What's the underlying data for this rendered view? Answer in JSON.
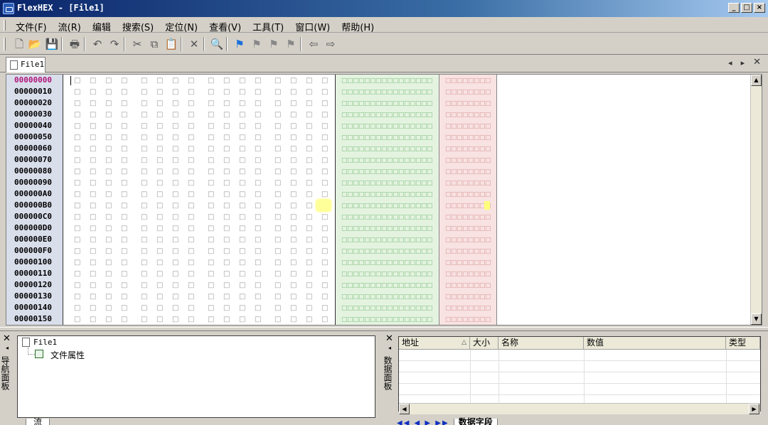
{
  "window": {
    "title": "FlexHEX - [File1]",
    "min_label": "_",
    "max_label": "□",
    "close_label": "×"
  },
  "menu": [
    "文件(F)",
    "流(R)",
    "编辑",
    "搜索(S)",
    "定位(N)",
    "查看(V)",
    "工具(T)",
    "窗口(W)",
    "帮助(H)"
  ],
  "toolbar": {
    "icons": [
      "new-file-icon",
      "open-folder-icon",
      "save-icon",
      "print-icon",
      "undo-icon",
      "redo-icon",
      "cut-icon",
      "copy-icon",
      "paste-icon",
      "delete-icon",
      "find-icon",
      "flag-icon",
      "flag-prev-icon",
      "flag-next-icon",
      "flag-clear-icon",
      "back-arrow-icon",
      "forward-arrow-icon"
    ],
    "glyphs": [
      "🗋",
      "📂",
      "💾",
      "🖶",
      "↶",
      "↷",
      "✂",
      "⧉",
      "📋",
      "✕",
      "🔍",
      "⚑",
      "⚑",
      "⚑",
      "⚑",
      "⇦",
      "⇨"
    ]
  },
  "tab": {
    "label": "File1",
    "prev": "◂",
    "next": "▸",
    "close": "✕"
  },
  "editor": {
    "addresses": [
      "00000000",
      "00000010",
      "00000020",
      "00000030",
      "00000040",
      "00000050",
      "00000060",
      "00000070",
      "00000080",
      "00000090",
      "000000A0",
      "000000B0",
      "000000C0",
      "000000D0",
      "000000E0",
      "000000F0",
      "00000100",
      "00000110",
      "00000120",
      "00000130",
      "00000140",
      "00000150"
    ],
    "hex_glyph": "□",
    "ascii_row": "□□□□□□□□□□□□□□□□",
    "unicode_row": "□□□□□□□□",
    "highlight_color": "#ffff9a",
    "colors": {
      "address_bg": "#d9deeb",
      "ascii_bg": "#e4f3e0",
      "unicode_bg": "#f8e2e2",
      "first_address": "#b0177a"
    }
  },
  "nav_panel": {
    "title": "导航面板",
    "root": "File1",
    "child": "文件属性",
    "tab": "流",
    "close": "✕",
    "dock": "◂"
  },
  "data_panel": {
    "title": "数据面板",
    "columns": [
      "地址",
      "大小",
      "名称",
      "数值",
      "类型"
    ],
    "tab": "数据字段",
    "nav_glyphs": "◀◀ ◀ ▶ ▶▶",
    "close": "✕",
    "dock": "◂",
    "sort_glyph": "△"
  }
}
